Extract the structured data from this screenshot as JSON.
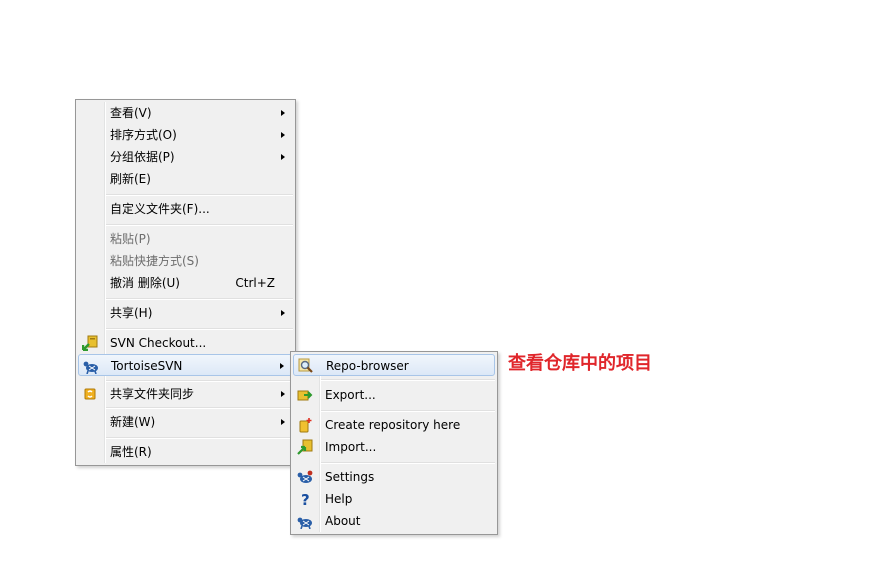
{
  "context_menu": {
    "items": [
      {
        "label": "查看(V)"
      },
      {
        "label": "排序方式(O)"
      },
      {
        "label": "分组依据(P)"
      },
      {
        "label": "刷新(E)"
      },
      {
        "label": "自定义文件夹(F)..."
      },
      {
        "label": "粘贴(P)",
        "disabled": true
      },
      {
        "label": "粘贴快捷方式(S)",
        "disabled": true
      },
      {
        "label": "撤消 删除(U)",
        "shortcut": "Ctrl+Z"
      },
      {
        "label": "共享(H)"
      },
      {
        "label": "SVN Checkout...",
        "icon": "svn-checkout-icon"
      },
      {
        "label": "TortoiseSVN",
        "icon": "tortoisesvn-icon"
      },
      {
        "label": "共享文件夹同步",
        "icon": "sync-icon"
      },
      {
        "label": "新建(W)"
      },
      {
        "label": "属性(R)"
      }
    ]
  },
  "submenu": {
    "items": [
      {
        "label": "Repo-browser",
        "icon": "magnifier-icon"
      },
      {
        "label": "Export...",
        "icon": "export-icon"
      },
      {
        "label": "Create repository here",
        "icon": "create-repository-icon"
      },
      {
        "label": "Import...",
        "icon": "import-icon"
      },
      {
        "label": "Settings",
        "icon": "settings-icon"
      },
      {
        "label": "Help",
        "icon": "help-icon"
      },
      {
        "label": "About",
        "icon": "about-icon"
      }
    ]
  },
  "annotation": {
    "text": "查看仓库中的项目",
    "color": "#e0262b"
  }
}
